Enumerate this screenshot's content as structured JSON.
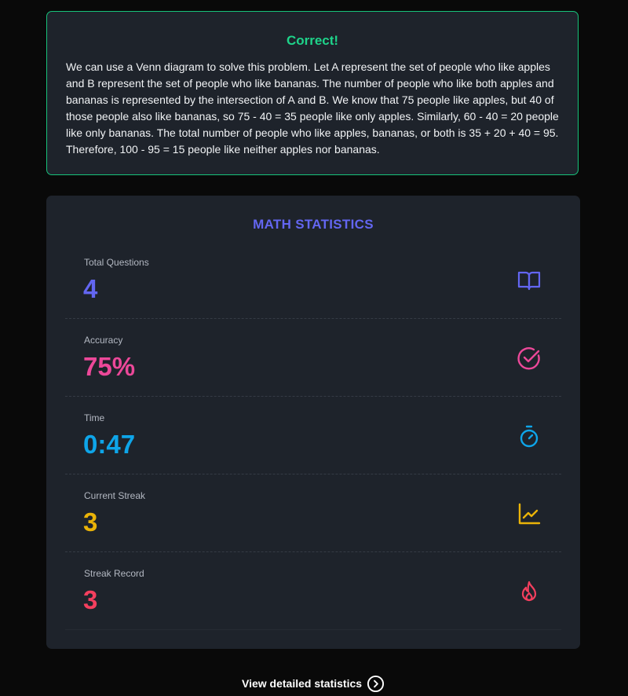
{
  "feedback": {
    "title": "Correct!",
    "text": "We can use a Venn diagram to solve this problem. Let A represent the set of people who like apples and B represent the set of people who like bananas. The number of people who like both apples and bananas is represented by the intersection of A and B. We know that 75 people like apples, but 40 of those people also like bananas, so 75 - 40 = 35 people like only apples. Similarly, 60 - 40 = 20 people like only bananas. The total number of people who like apples, bananas, or both is 35 + 20 + 40 = 95. Therefore, 100 - 95 = 15 people like neither apples nor bananas.",
    "accent_color": "#1ed38a"
  },
  "stats": {
    "title": "MATH STATISTICS",
    "title_color": "#6366f1",
    "items": [
      {
        "label": "Total Questions",
        "value": "4",
        "icon": "book-open-icon",
        "color": "#6366f1"
      },
      {
        "label": "Accuracy",
        "value": "75%",
        "icon": "circle-check-icon",
        "color": "#ec4899"
      },
      {
        "label": "Time",
        "value": "0:47",
        "icon": "stopwatch-icon",
        "color": "#0ea5e9"
      },
      {
        "label": "Current Streak",
        "value": "3",
        "icon": "line-chart-icon",
        "color": "#eab308"
      },
      {
        "label": "Streak Record",
        "value": "3",
        "icon": "flame-icon",
        "color": "#f43f5e"
      }
    ]
  },
  "footer": {
    "link_label": "View detailed statistics",
    "icon": "chevron-right-circle-icon"
  }
}
